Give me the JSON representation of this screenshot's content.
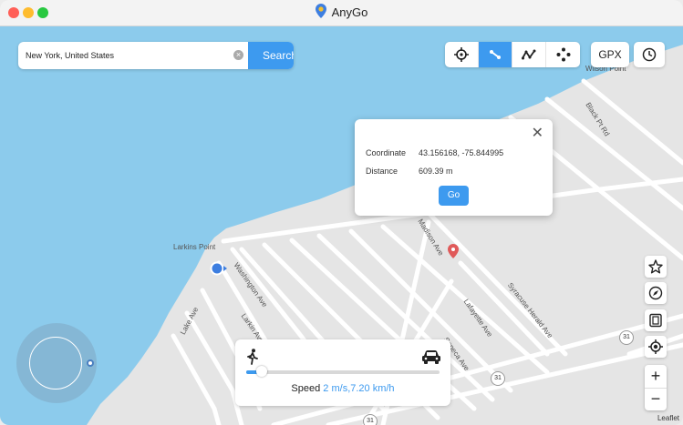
{
  "window": {
    "title": "AnyGo"
  },
  "search": {
    "value": "New York, United States",
    "button_label": "Search"
  },
  "toolbar": {
    "modes": [
      {
        "icon": "crosshair-icon",
        "active": false
      },
      {
        "icon": "two-spot-route-icon",
        "active": true
      },
      {
        "icon": "multi-spot-route-icon",
        "active": false
      },
      {
        "icon": "joystick-mode-icon",
        "active": false
      }
    ],
    "gpx_label": "GPX",
    "history_icon": "clock-icon"
  },
  "popup": {
    "coordinate_label": "Coordinate",
    "coordinate_value": "43.156168, -75.844995",
    "distance_label": "Distance",
    "distance_value": "609.39 m",
    "go_label": "Go"
  },
  "speed": {
    "label": "Speed",
    "value": "2 m/s,7.20 km/h",
    "slider_fraction": 0.08,
    "walk_icon": "walking-icon",
    "car_icon": "car-icon"
  },
  "map": {
    "places": [
      {
        "name": "Larkins Point"
      },
      {
        "name": "Wilson Point"
      }
    ],
    "roads": [
      "Black Pt Rd",
      "Madison Ave",
      "Washington Ave",
      "Larkin Ave",
      "Lake Ave",
      "Lafayette Ave",
      "Seneca Ave",
      "Syracuse Herald Ave"
    ],
    "route_badges": [
      "31",
      "31",
      "31"
    ],
    "attribution": "Leaflet"
  },
  "colors": {
    "accent": "#3d9aef",
    "water": "#8ccbec",
    "land": "#e5e5e5"
  }
}
